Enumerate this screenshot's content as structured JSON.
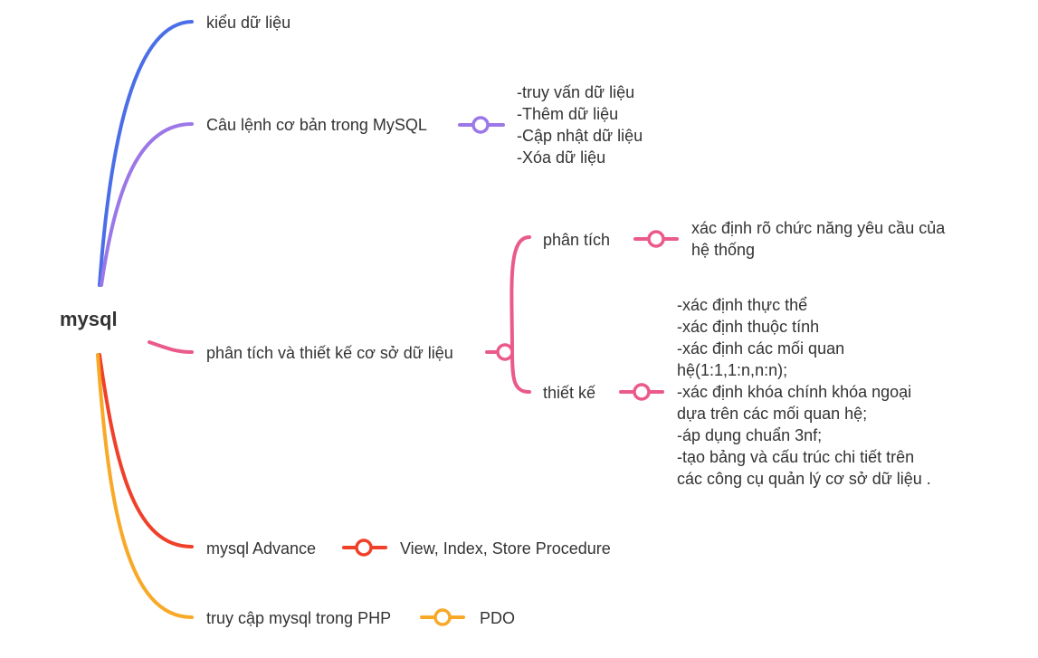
{
  "root": {
    "label": "mysql"
  },
  "branches": [
    {
      "id": "b1",
      "label": "kiểu dữ liệu",
      "color": "#4a6ee8"
    },
    {
      "id": "b2",
      "label": "Câu lệnh cơ bản trong MySQL",
      "color": "#9b77e8",
      "detail": [
        "-truy vấn dữ liệu",
        "-Thêm dữ liệu",
        "-Cập nhật dữ liệu",
        "-Xóa dữ liệu"
      ]
    },
    {
      "id": "b3",
      "label": "phân tích và thiết kế cơ sở dữ liệu",
      "color": "#ea5a8a",
      "children": [
        {
          "id": "b3a",
          "label": "phân tích",
          "detail": [
            "xác định rõ chức năng yêu cầu của",
            "hệ thống"
          ]
        },
        {
          "id": "b3b",
          "label": "thiết kế",
          "detail": [
            "-xác định thực thể",
            "-xác định thuộc tính",
            "-xác định các mối quan",
            "hệ(1:1,1:n,n:n);",
            "-xác định khóa chính khóa ngoại",
            "dựa trên các mối quan hệ;",
            "-áp dụng chuẩn 3nf;",
            "-tạo bảng và cấu trúc chi tiết trên",
            "các công cụ quản lý cơ sở dữ liệu ."
          ]
        }
      ]
    },
    {
      "id": "b4",
      "label": "mysql Advance",
      "color": "#f0402a",
      "detail": [
        "View, Index, Store Procedure"
      ]
    },
    {
      "id": "b5",
      "label": "truy cập mysql trong PHP",
      "color": "#f8a928",
      "detail": [
        "PDO"
      ]
    }
  ]
}
